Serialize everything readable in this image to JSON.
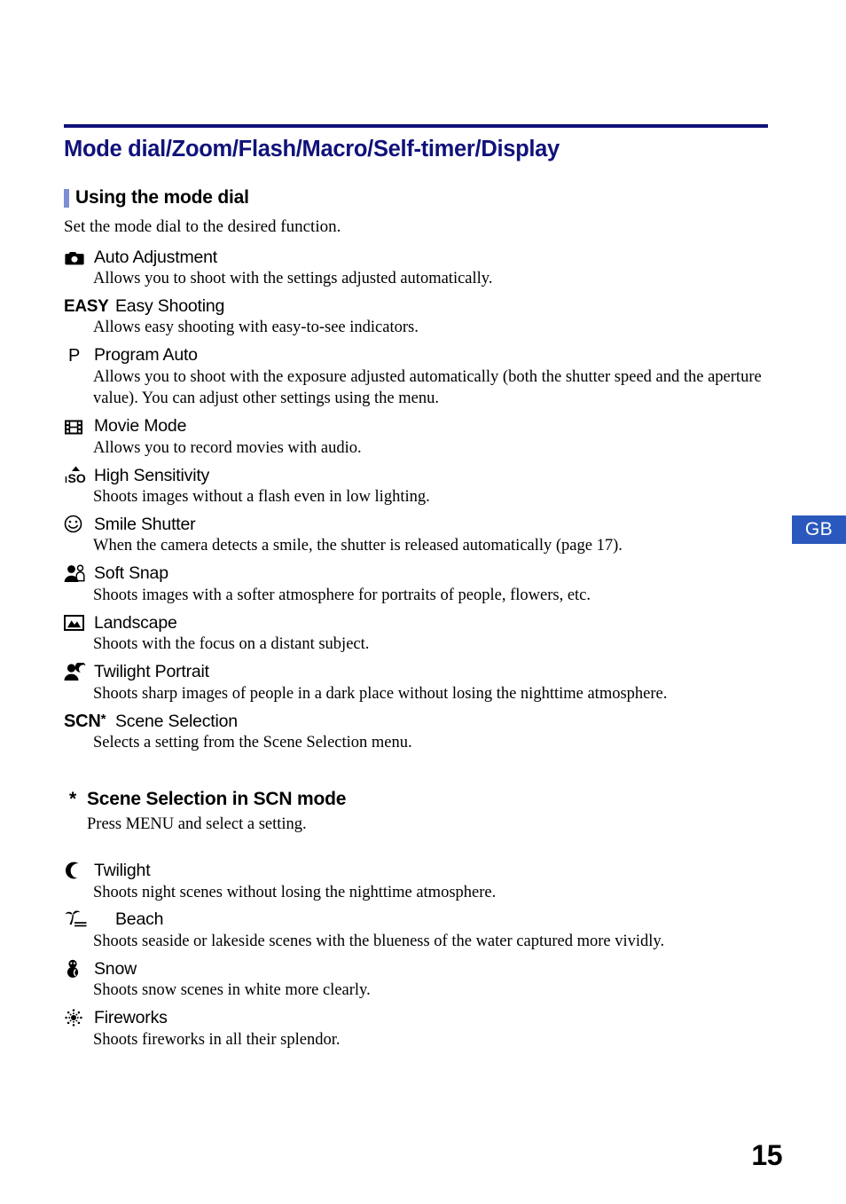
{
  "document": {
    "title": "Mode dial/Zoom/Flash/Macro/Self-timer/Display",
    "title_color": "#10127a",
    "region_tab": "GB",
    "region_tab_color": "#2a58bd",
    "page_number": "15"
  },
  "section": {
    "heading": "Using the mode dial",
    "heading_marker_color": "#7e8dd4",
    "intro": "Set the mode dial to the desired function."
  },
  "modes": [
    {
      "icon": "camera-auto-icon",
      "label": "Auto Adjustment",
      "description": "Allows you to shoot with the settings adjusted automatically."
    },
    {
      "icon": "easy-text-icon",
      "icon_text": "EASY",
      "label": "Easy Shooting",
      "description": "Allows easy shooting with easy-to-see indicators."
    },
    {
      "icon": "program-p-icon",
      "icon_text": "P",
      "label": "Program Auto",
      "description": "Allows you to shoot with the exposure adjusted automatically (both the shutter speed and the aperture value). You can adjust other settings using the menu."
    },
    {
      "icon": "film-strip-icon",
      "label": "Movie Mode",
      "description": "Allows you to record movies with audio."
    },
    {
      "icon": "iso-high-sensitivity-icon",
      "label": "High Sensitivity",
      "description": "Shoots images without a flash even in low lighting."
    },
    {
      "icon": "smiley-face-icon",
      "label": "Smile Shutter",
      "description": "When the camera detects a smile, the shutter is released automatically (page 17)."
    },
    {
      "icon": "two-people-icon",
      "label": "Soft Snap",
      "description": "Shoots images with a softer atmosphere for portraits of people, flowers, etc."
    },
    {
      "icon": "mountain-landscape-icon",
      "label": "Landscape",
      "description": "Shoots with the focus on a distant subject."
    },
    {
      "icon": "person-moon-icon",
      "label": "Twilight Portrait",
      "description": "Shoots sharp images of people in a dark place without losing the nighttime atmosphere."
    },
    {
      "icon": "scn-text-icon",
      "icon_text": "SCN",
      "icon_superscript": "*",
      "label": "Scene Selection",
      "description": "Selects a setting from the Scene Selection menu."
    }
  ],
  "scene_section": {
    "star": "*",
    "heading": "Scene Selection in SCN mode",
    "subtitle": "Press MENU and select a setting.",
    "items": [
      {
        "icon": "crescent-moon-icon",
        "label": "Twilight",
        "description": "Shoots night scenes without losing the nighttime atmosphere."
      },
      {
        "icon": "palm-tree-beach-icon",
        "label": "Beach",
        "description": "Shoots seaside or lakeside scenes with the blueness of the water captured more vividly."
      },
      {
        "icon": "snowman-icon",
        "label": "Snow",
        "description": "Shoots snow scenes in white more clearly."
      },
      {
        "icon": "fireworks-burst-icon",
        "label": "Fireworks",
        "description": "Shoots fireworks in all their splendor."
      }
    ]
  }
}
